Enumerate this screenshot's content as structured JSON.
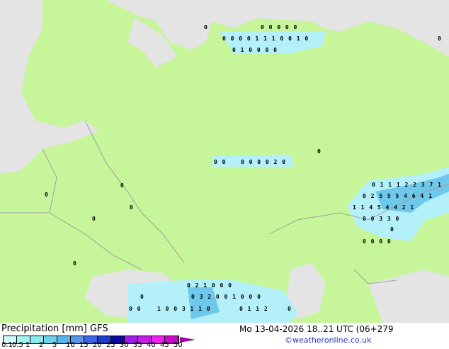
{
  "map": {
    "land_color": "#c6f59a",
    "sea_color": "#e4e4e4",
    "border_color": "#a0a0a0",
    "precip_labels": [
      "0",
      "0 0 0 0 0",
      "0 0 0 0 1 1 1 0 0 1 0",
      "0 1 0 0 0 0",
      "0",
      "0 0",
      "0 0 0 0 2 0",
      "0",
      "0 1 1 1 2 2 3 7 1",
      "0 2 5 5 5 4 6 4 1",
      "1 1 4 5 4 4 2 1",
      "0 0 3 3 0",
      "0",
      "0 0 0 0",
      "0",
      "0",
      "0",
      "0",
      "0",
      "0 2 1 0 0 0",
      "0 3 2 0 0 1 0 0 0",
      "0",
      "0 0",
      "1 0 0 3 1 1 0",
      "0 1 1 2",
      "0"
    ]
  },
  "legend": {
    "title": "Precipitation [mm]  GFS",
    "date": "Mo 13-04-2026 18..21 UTC (06+279",
    "credit": "©weatheronline.co.uk",
    "colors": [
      "#d2fafa",
      "#a0f5f5",
      "#8cebeb",
      "#6ed2eb",
      "#5ab4eb",
      "#5a96e6",
      "#3c64e6",
      "#1e3cc8",
      "#0a0a9b",
      "#9b1ee6",
      "#c31ee6",
      "#f01ef0",
      "#c80ac8"
    ],
    "ticks": [
      "0.1",
      "0.5",
      "1",
      "2",
      "5",
      "10",
      "15",
      "20",
      "25",
      "30",
      "35",
      "40",
      "45",
      "50"
    ]
  }
}
